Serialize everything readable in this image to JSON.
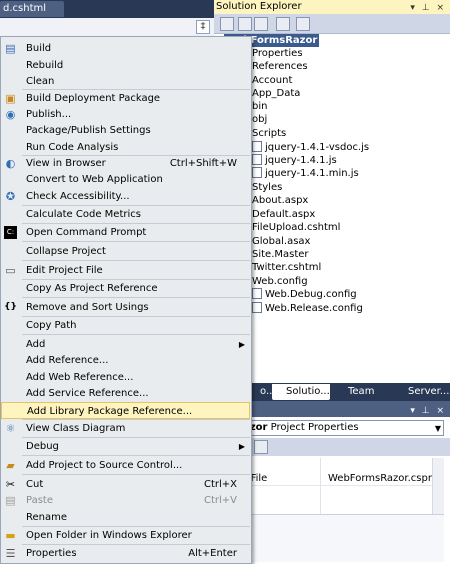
{
  "editor": {
    "tab_label": "d.cshtml",
    "split_symbol": "‡"
  },
  "solution_explorer": {
    "title": "Solution Explorer",
    "title_buttons": "▾ ⊥ ×",
    "items": [
      {
        "label": "WebFormsRazor",
        "selected": true
      },
      {
        "label": "Properties"
      },
      {
        "label": "References"
      },
      {
        "label": "Account"
      },
      {
        "label": "App_Data"
      },
      {
        "label": "bin"
      },
      {
        "label": "obj"
      },
      {
        "label": "Scripts"
      },
      {
        "label": "jquery-1.4.1-vsdoc.js"
      },
      {
        "label": "jquery-1.4.1.js"
      },
      {
        "label": "jquery-1.4.1.min.js"
      },
      {
        "label": "Styles"
      },
      {
        "label": "About.aspx"
      },
      {
        "label": "Default.aspx"
      },
      {
        "label": "FileUpload.cshtml"
      },
      {
        "label": "Global.asax"
      },
      {
        "label": "Site.Master"
      },
      {
        "label": "Twitter.cshtml"
      },
      {
        "label": "Web.config"
      },
      {
        "label": "Web.Debug.config"
      },
      {
        "label": "Web.Release.config"
      }
    ],
    "tabs": [
      "o...",
      "Solutio...",
      "Team E...",
      "Server..."
    ]
  },
  "properties": {
    "title_buttons": "▾ ⊥ ×",
    "selector_bold": "msRazor",
    "selector_rest": " Project Properties",
    "row_name": "ct File",
    "row_value": "WebFormsRazor.csproj"
  },
  "context_menu": {
    "items": [
      {
        "label": "Build",
        "icon": "build-icon"
      },
      {
        "label": "Rebuild"
      },
      {
        "label": "Clean"
      },
      {
        "label": "Build Deployment Package",
        "icon": "package-icon"
      },
      {
        "label": "Publish...",
        "icon": "publish-icon"
      },
      {
        "label": "Package/Publish Settings"
      },
      {
        "label": "Run Code Analysis"
      },
      {
        "label": "View in Browser",
        "shortcut": "Ctrl+Shift+W"
      },
      {
        "label": "Convert to Web Application"
      },
      {
        "label": "Check Accessibility...",
        "icon": "accessibility-icon"
      },
      {
        "label": "Calculate Code Metrics"
      },
      {
        "label": "Open Command Prompt",
        "icon": "command-prompt-icon"
      },
      {
        "label": "Collapse Project"
      },
      {
        "label": "Edit Project File",
        "icon": "edit-file-icon"
      },
      {
        "label": "Copy As Project Reference"
      },
      {
        "label": "Remove and Sort Usings",
        "icon": "usings-icon"
      },
      {
        "label": "Copy Path"
      },
      {
        "label": "Add"
      },
      {
        "label": "Add Reference..."
      },
      {
        "label": "Add Web Reference..."
      },
      {
        "label": "Add Service Reference..."
      },
      {
        "label": "Add Library Package Reference..."
      },
      {
        "label": "View Class Diagram",
        "icon": "class-diagram-icon"
      },
      {
        "label": "Debug"
      },
      {
        "label": "Add Project to Source Control...",
        "icon": "source-control-icon"
      },
      {
        "label": "Cut",
        "shortcut": "Ctrl+X",
        "icon": "cut-icon"
      },
      {
        "label": "Paste",
        "shortcut": "Ctrl+V",
        "icon": "paste-icon"
      },
      {
        "label": "Rename"
      },
      {
        "label": "Open Folder in Windows Explorer",
        "icon": "folder-icon"
      },
      {
        "label": "Properties",
        "shortcut": "Alt+Enter",
        "icon": "properties-icon"
      }
    ]
  }
}
